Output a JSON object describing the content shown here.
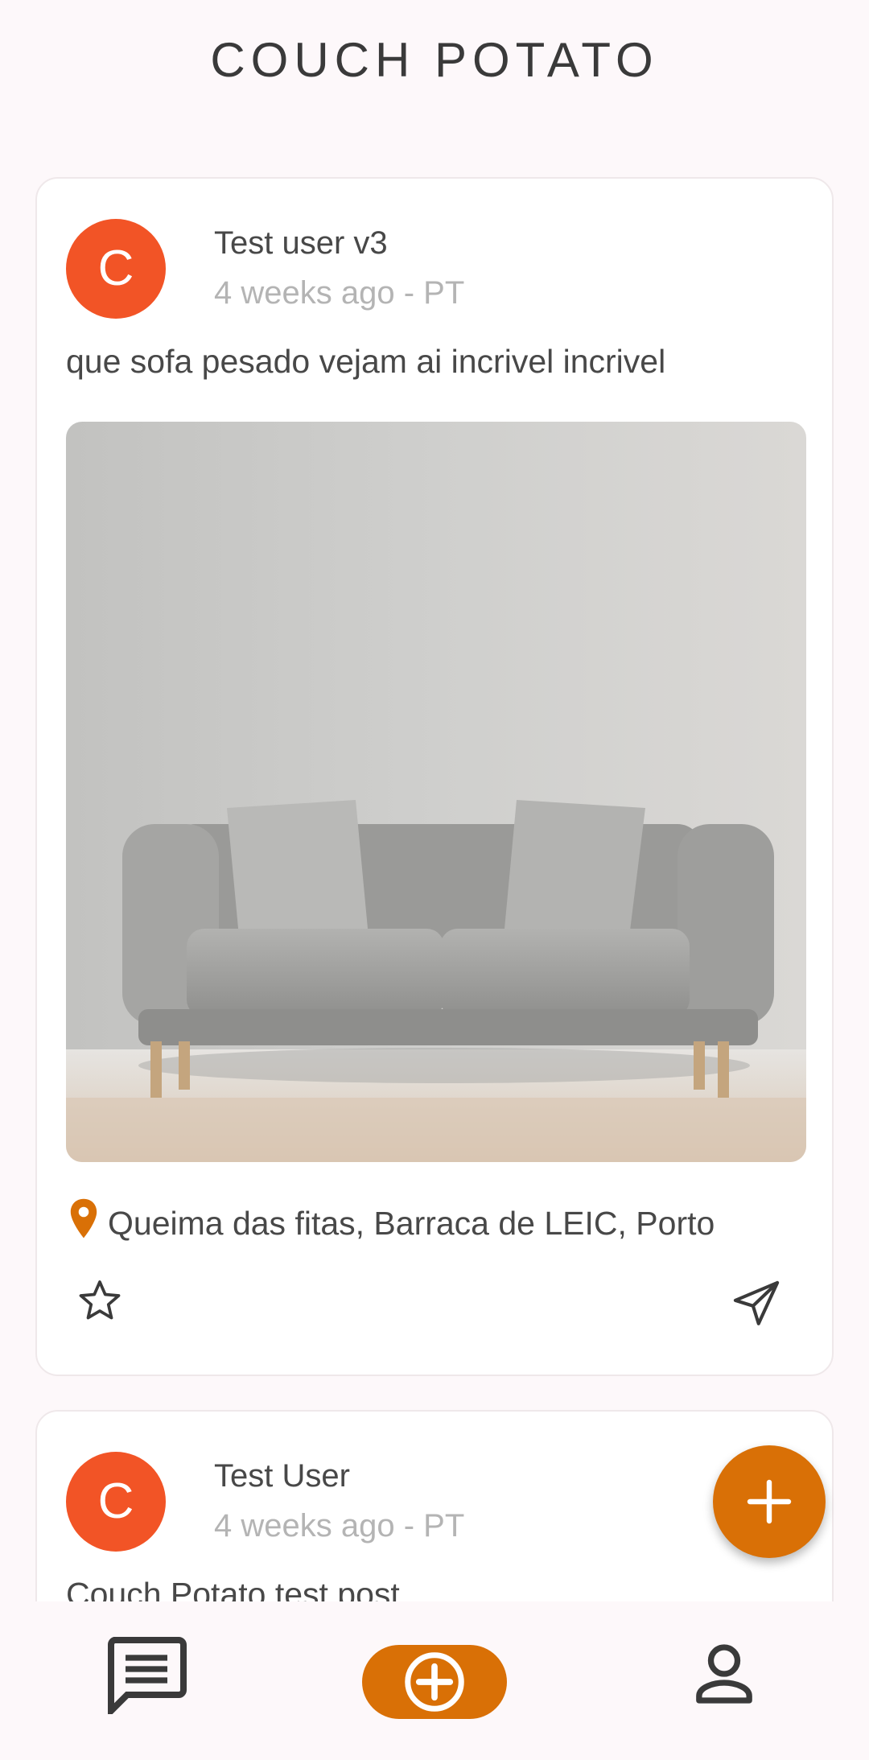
{
  "app": {
    "title": "COUCH POTATO"
  },
  "posts": [
    {
      "avatar_letter": "C",
      "username": "Test user v3",
      "meta": "4 weeks ago - PT",
      "text": "que sofa pesado vejam ai incrivel incrivel",
      "image": "sofa-photo",
      "location": "Queima das fitas, Barraca de LEIC, Porto"
    },
    {
      "avatar_letter": "C",
      "username": "Test User",
      "meta": "4 weeks ago - PT",
      "text": "Couch Potato test post"
    }
  ],
  "icons": {
    "star": "star-outline-icon",
    "send": "send-icon",
    "location": "location-pin-icon",
    "fab": "plus-icon",
    "nav_chat": "chat-icon",
    "nav_add": "add-circle-icon",
    "nav_profile": "person-icon"
  },
  "colors": {
    "accent": "#d97006",
    "avatar": "#f25426",
    "background": "#fdf8fa"
  }
}
